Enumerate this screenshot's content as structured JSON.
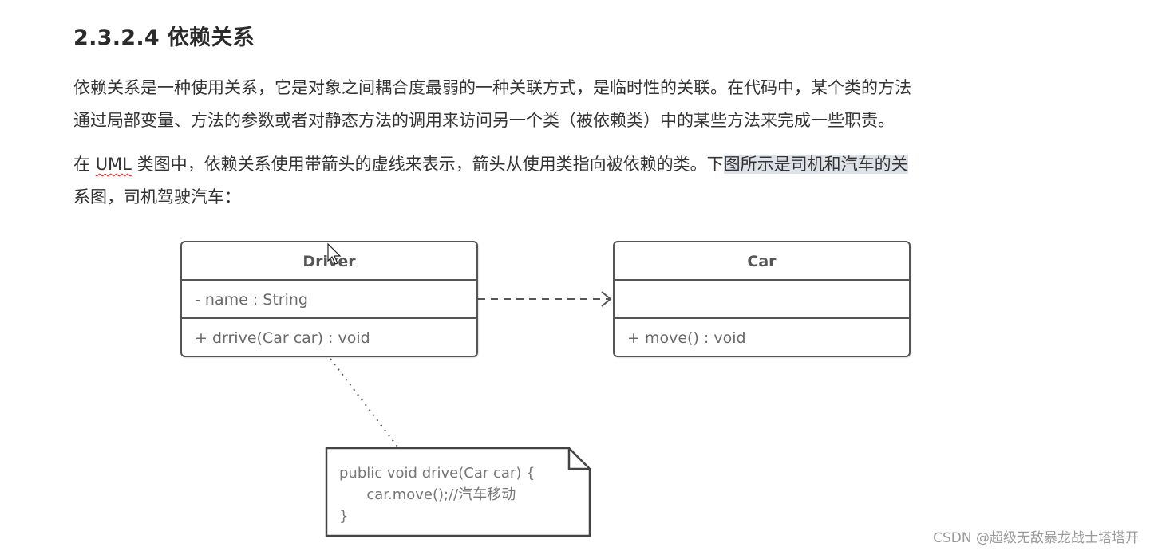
{
  "heading": "2.3.2.4 依赖关系",
  "paragraphs": {
    "p1_line1": "依赖关系是一种使用关系，它是对象之间耦合度最弱的一种关联方式，是临时性的关联。在代码中，某个类的方法",
    "p1_line2": "通过局部变量、方法的参数或者对静态方法的调用来访问另一个类（被依赖类）中的某些方法来完成一些职责。",
    "p2_pre": "在 ",
    "p2_uml": "UML",
    "p2_mid": " 类图中，依赖关系使用带箭头的虚线来表示，箭头从使用类指向被依赖的类。下",
    "p2_highlight": "图所示是司机和汽车的关",
    "p2_line2": "系图，司机驾驶汽车："
  },
  "diagram": {
    "driver": {
      "name": "Driver",
      "attribute": "- name : String",
      "operation": "+ drrive(Car car) : void"
    },
    "car": {
      "name": "Car",
      "attribute": "",
      "operation": "+ move() : void"
    },
    "relation": "dependency",
    "note": {
      "line1": "public void drive(Car car) {",
      "line2": "      car.move();//汽车移动",
      "line3": "}"
    }
  },
  "watermark": "CSDN @超级无敌暴龙战士塔塔开",
  "colors": {
    "text": "#333333",
    "uml_border": "#555555",
    "highlight": "#dde2e8",
    "spellcheck": "#e02020"
  }
}
